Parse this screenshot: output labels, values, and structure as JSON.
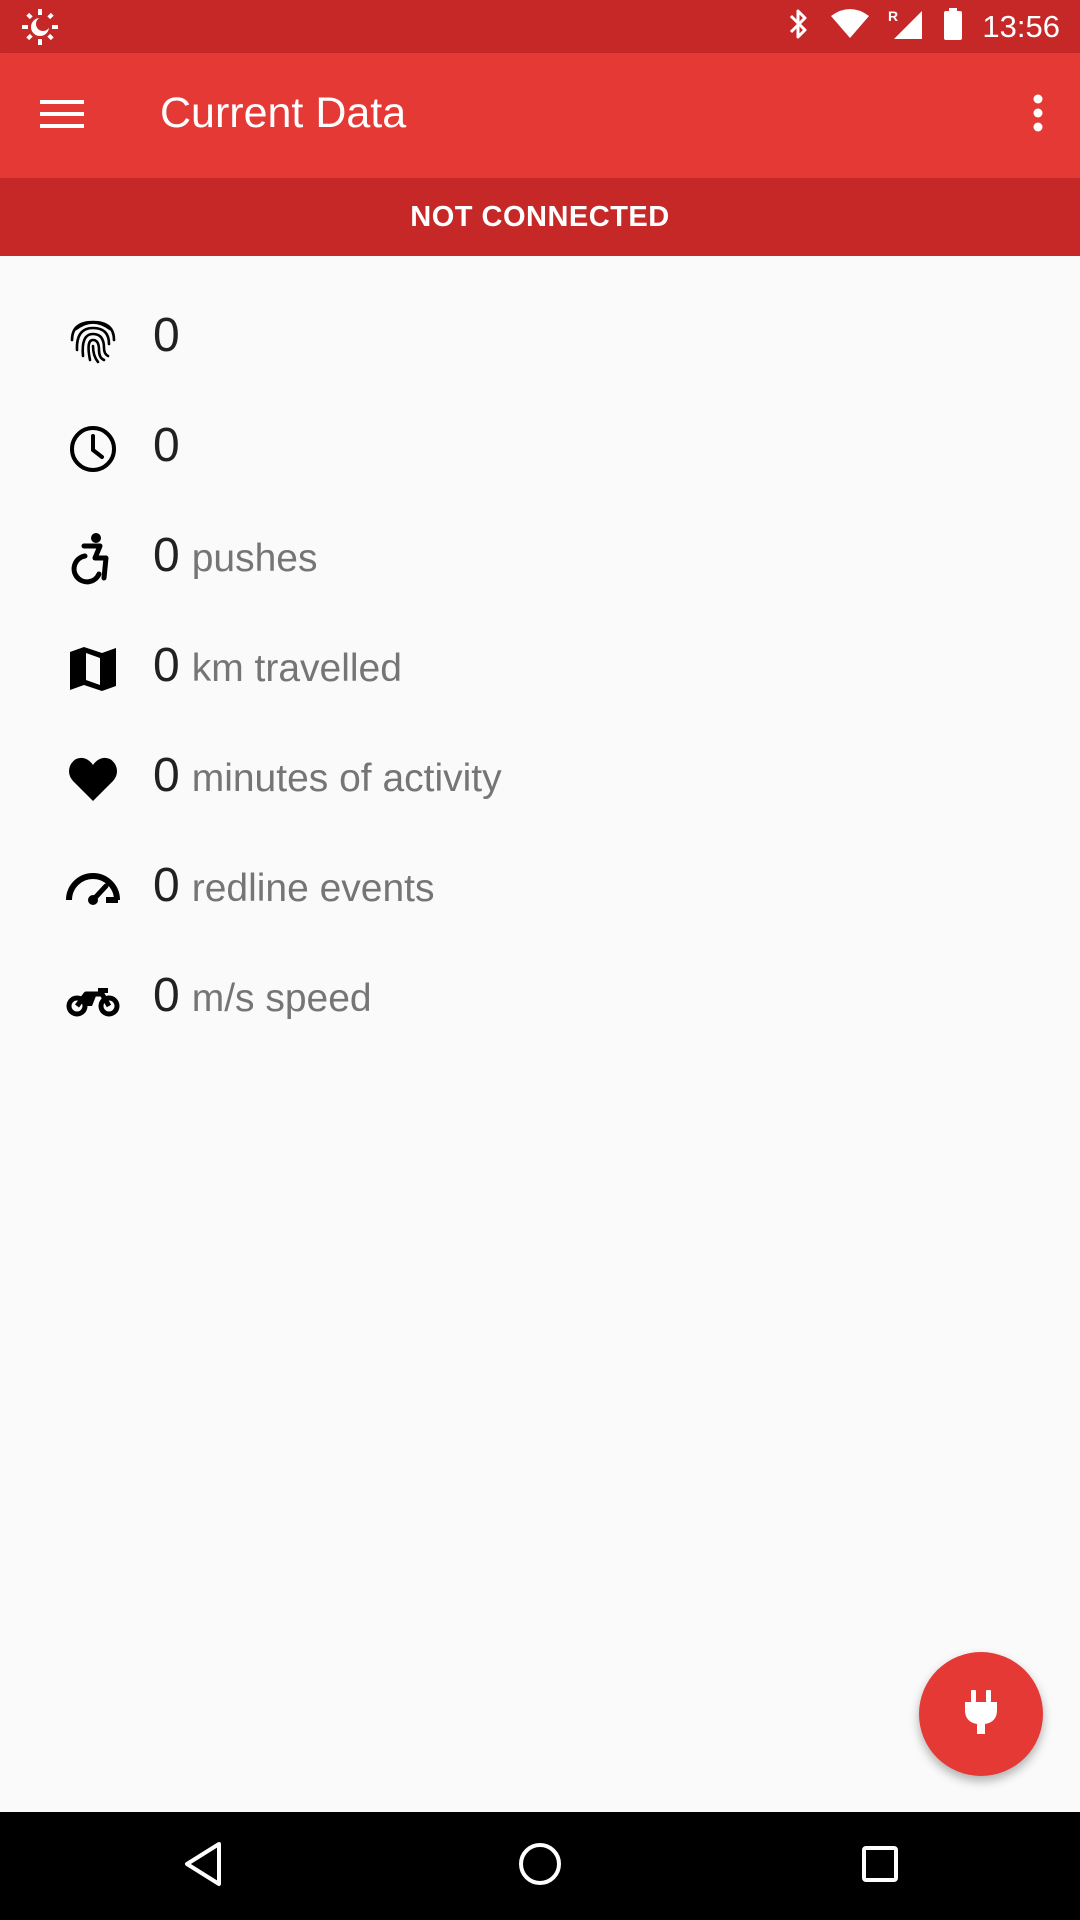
{
  "status_bar": {
    "time": "13:56",
    "left_icon": "brightness-icon",
    "icons": [
      "bluetooth-icon",
      "wifi-icon",
      "signal-roaming-icon",
      "battery-icon"
    ]
  },
  "app_bar": {
    "title": "Current Data",
    "menu_icon": "menu-icon",
    "overflow_icon": "more-vert-icon"
  },
  "connection": {
    "status": "NOT CONNECTED"
  },
  "metrics": [
    {
      "icon": "fingerprint-icon",
      "value": "0",
      "unit": ""
    },
    {
      "icon": "clock-icon",
      "value": "0",
      "unit": ""
    },
    {
      "icon": "accessible-icon",
      "value": "0",
      "unit": "pushes"
    },
    {
      "icon": "map-icon",
      "value": "0",
      "unit": "km travelled"
    },
    {
      "icon": "heart-icon",
      "value": "0",
      "unit": "minutes of activity"
    },
    {
      "icon": "speedometer-icon",
      "value": "0",
      "unit": "redline events"
    },
    {
      "icon": "motorbike-icon",
      "value": "0",
      "unit": "m/s speed"
    }
  ],
  "fab": {
    "icon": "power-plug-icon"
  },
  "nav_bar": {
    "icons": [
      "back-icon",
      "home-icon",
      "recents-icon"
    ]
  },
  "colors": {
    "primary": "#e53935",
    "primary_dark": "#c62828",
    "background": "#fafafa",
    "value_text": "#212121",
    "unit_text": "#757575"
  }
}
